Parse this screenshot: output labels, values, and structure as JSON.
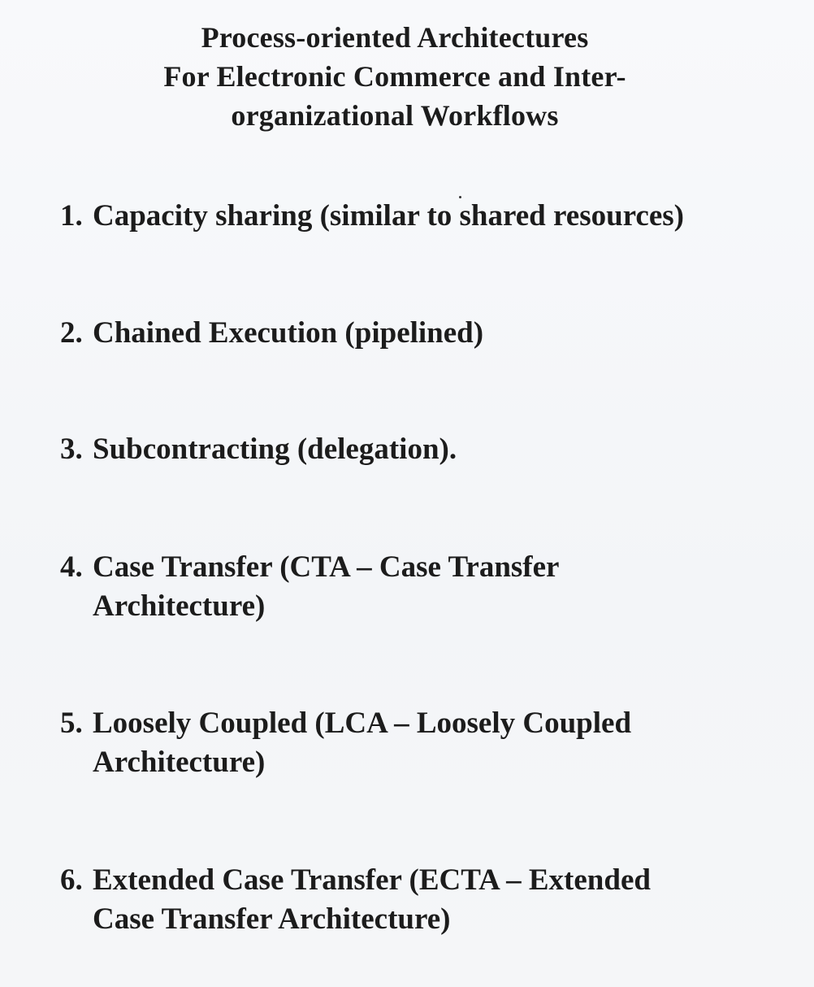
{
  "title": {
    "lines": [
      "Process-oriented Architectures",
      "For Electronic Commerce and Inter-",
      "organizational Workflows"
    ]
  },
  "items": [
    {
      "number": "1.",
      "lines": [
        "Capacity sharing (similar to shared resources)"
      ]
    },
    {
      "number": "2.",
      "lines": [
        "Chained Execution (pipelined)"
      ]
    },
    {
      "number": "3.",
      "lines": [
        "Subcontracting (delegation)."
      ]
    },
    {
      "number": "4.",
      "lines": [
        "Case Transfer (CTA – Case Transfer",
        "Architecture)"
      ]
    },
    {
      "number": "5.",
      "lines": [
        "Loosely Coupled (LCA – Loosely Coupled",
        "Architecture)"
      ]
    },
    {
      "number": "6.",
      "lines": [
        "Extended Case Transfer (ECTA – Extended",
        "Case Transfer Architecture)"
      ]
    }
  ]
}
